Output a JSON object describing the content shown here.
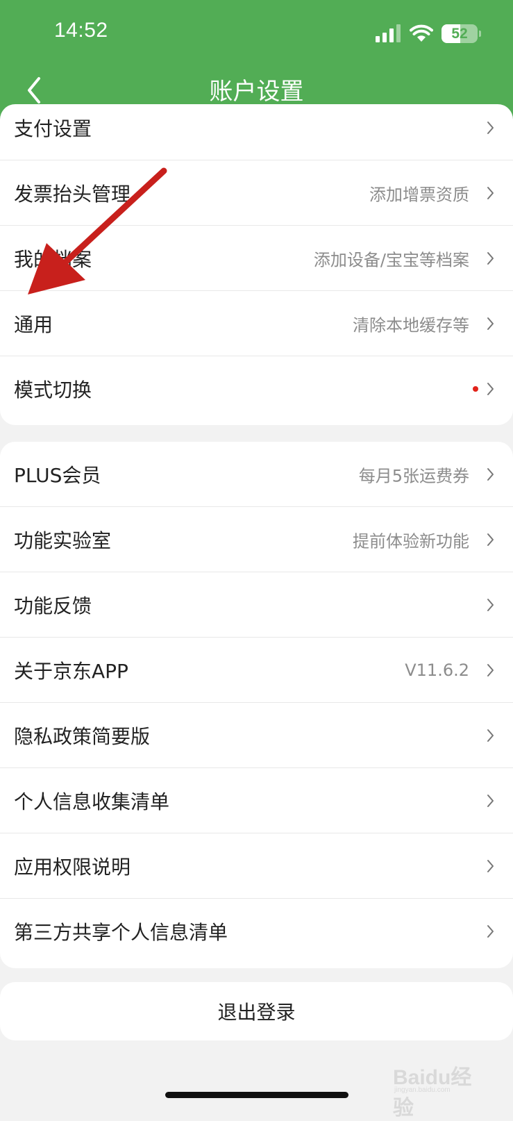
{
  "status_bar": {
    "time": "14:52",
    "battery": "52",
    "battery_level": 0.52
  },
  "header": {
    "title": "账户设置",
    "back_icon": "chevron-left-icon"
  },
  "section1": {
    "items": [
      {
        "label": "支付设置",
        "value": ""
      },
      {
        "label": "发票抬头管理",
        "value": "添加增票资质"
      },
      {
        "label": "我的档案",
        "value": "添加设备/宝宝等档案"
      },
      {
        "label": "通用",
        "value": "清除本地缓存等"
      },
      {
        "label": "模式切换",
        "value": "",
        "badge": "red-dot"
      }
    ]
  },
  "section2": {
    "items": [
      {
        "label": "PLUS会员",
        "value": "每月5张运费券"
      },
      {
        "label": "功能实验室",
        "value": "提前体验新功能"
      },
      {
        "label": "功能反馈",
        "value": ""
      },
      {
        "label": "关于京东APP",
        "value": "V11.6.2"
      },
      {
        "label": "隐私政策简要版",
        "value": ""
      },
      {
        "label": "个人信息收集清单",
        "value": ""
      },
      {
        "label": "应用权限说明",
        "value": ""
      },
      {
        "label": "第三方共享个人信息清单",
        "value": ""
      }
    ]
  },
  "logout": {
    "label": "退出登录"
  },
  "watermark": {
    "brand": "Baidu经验",
    "url": "jingyan.baidu.com"
  },
  "colors": {
    "header_bg": "#52ad55",
    "page_bg": "#f2f2f2",
    "annotation_arrow": "#c8201c",
    "badge_dot": "#e2231a"
  }
}
